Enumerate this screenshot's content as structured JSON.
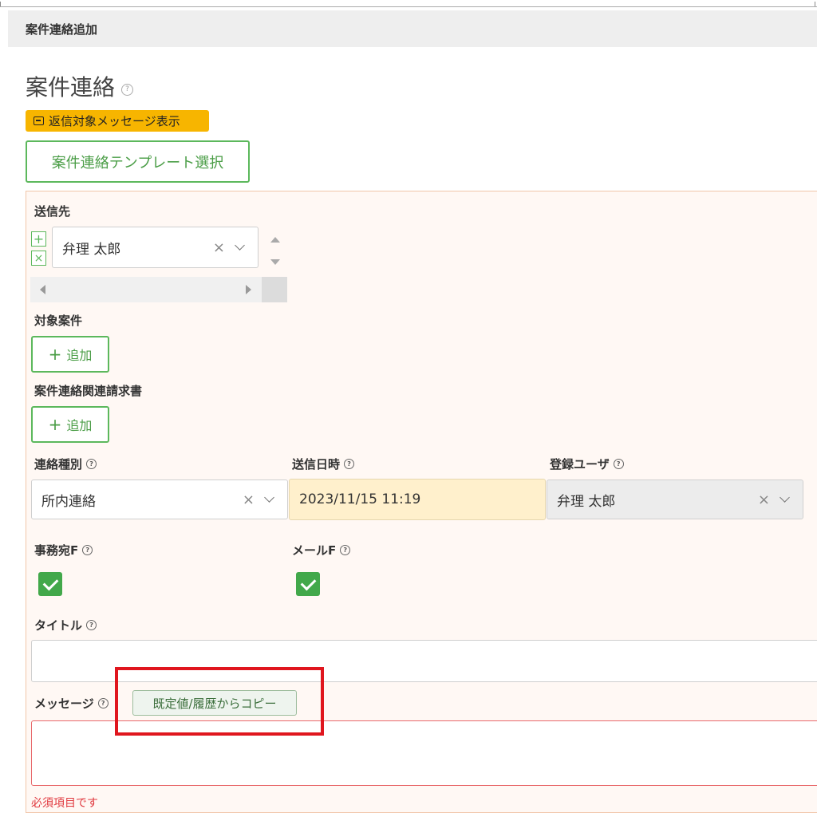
{
  "dialog": {
    "header_title": "案件連絡追加",
    "page_title": "案件連絡"
  },
  "buttons": {
    "reply_message": "返信対象メッセージ表示",
    "template_select": "案件連絡テンプレート選択",
    "add_label": "追加",
    "copy_from_history": "既定値/履歴からコピー"
  },
  "form": {
    "recipient": {
      "label": "送信先",
      "value": "弁理 太郎",
      "add_icon": "plus-icon",
      "remove_icon": "close-icon"
    },
    "target_case": {
      "label": "対象案件"
    },
    "related_invoice": {
      "label": "案件連絡関連請求書"
    },
    "contact_type": {
      "label": "連絡種別",
      "value": "所内連絡"
    },
    "send_datetime": {
      "label": "送信日時",
      "value": "2023/11/15 11:19"
    },
    "registered_user": {
      "label": "登録ユーザ",
      "value": "弁理 太郎"
    },
    "office_flag": {
      "label": "事務宛F",
      "checked": true
    },
    "mail_flag": {
      "label": "メールF",
      "checked": true
    },
    "title": {
      "label": "タイトル",
      "value": ""
    },
    "message": {
      "label": "メッセージ",
      "value": "",
      "error": "必須項目です"
    }
  },
  "glyphs": {
    "clear": "×",
    "plus": "+",
    "help": "?"
  },
  "colors": {
    "accent_green": "#5cb85c",
    "reply_yellow": "#f7b500",
    "panel_bg": "#fff8f4",
    "error_red": "#e0161e"
  }
}
